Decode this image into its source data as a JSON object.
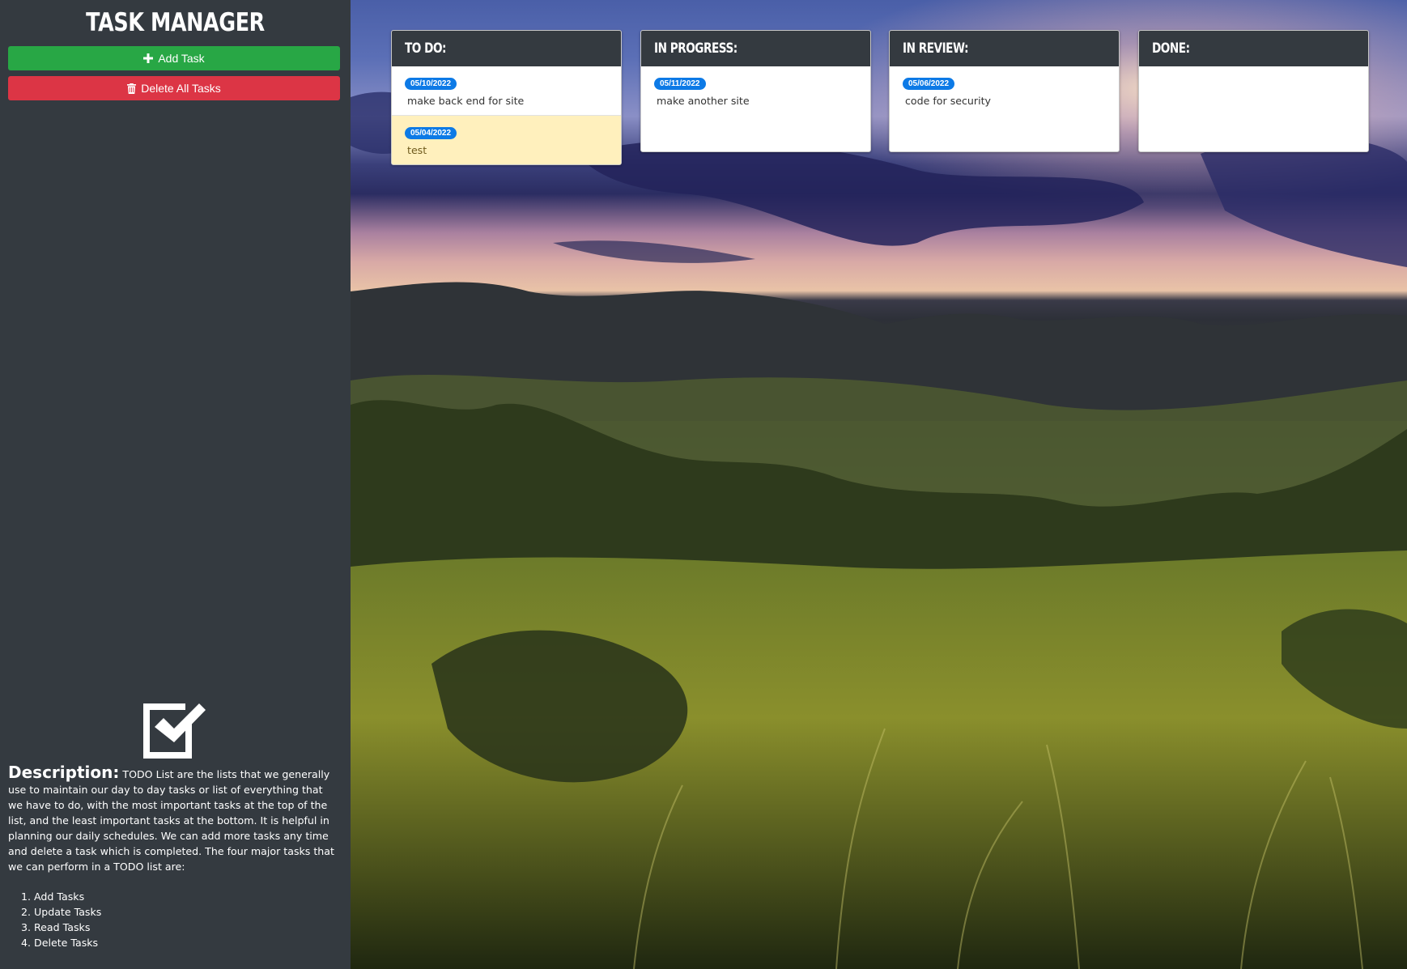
{
  "sidebar": {
    "title": "Task Manager",
    "add_button": {
      "label": "Add Task",
      "icon": "plus-icon"
    },
    "delete_button": {
      "label": "Delete All Tasks",
      "icon": "trash-icon"
    },
    "logo_icon": "checkbox-icon",
    "description": {
      "label": "Description:",
      "text": "TODO List are the lists that we generally use to maintain our day to day tasks or list of everything that we have to do, with the most important tasks at the top of the list, and the least important tasks at the bottom. It is helpful in planning our daily schedules. We can add more tasks any time and delete a task which is completed. The four major tasks that we can perform in a TODO list are:"
    },
    "features": [
      "Add Tasks",
      "Update Tasks",
      "Read Tasks",
      "Delete Tasks"
    ]
  },
  "board": {
    "columns": [
      {
        "title": "To Do:",
        "tasks": [
          {
            "date": "05/10/2022",
            "text": "make back end for site",
            "highlight": false
          },
          {
            "date": "05/04/2022",
            "text": "test",
            "highlight": true
          }
        ]
      },
      {
        "title": "In Progress:",
        "tasks": [
          {
            "date": "05/11/2022",
            "text": "make another site",
            "highlight": false
          }
        ]
      },
      {
        "title": "In Review:",
        "tasks": [
          {
            "date": "05/06/2022",
            "text": "code for security",
            "highlight": false
          }
        ]
      },
      {
        "title": "Done:",
        "tasks": []
      }
    ]
  },
  "colors": {
    "sidebar_bg": "#343a40",
    "add_button": "#28a745",
    "delete_button": "#dc3545",
    "date_badge": "#0d7ae6",
    "highlight_task": "#fff0bd"
  }
}
